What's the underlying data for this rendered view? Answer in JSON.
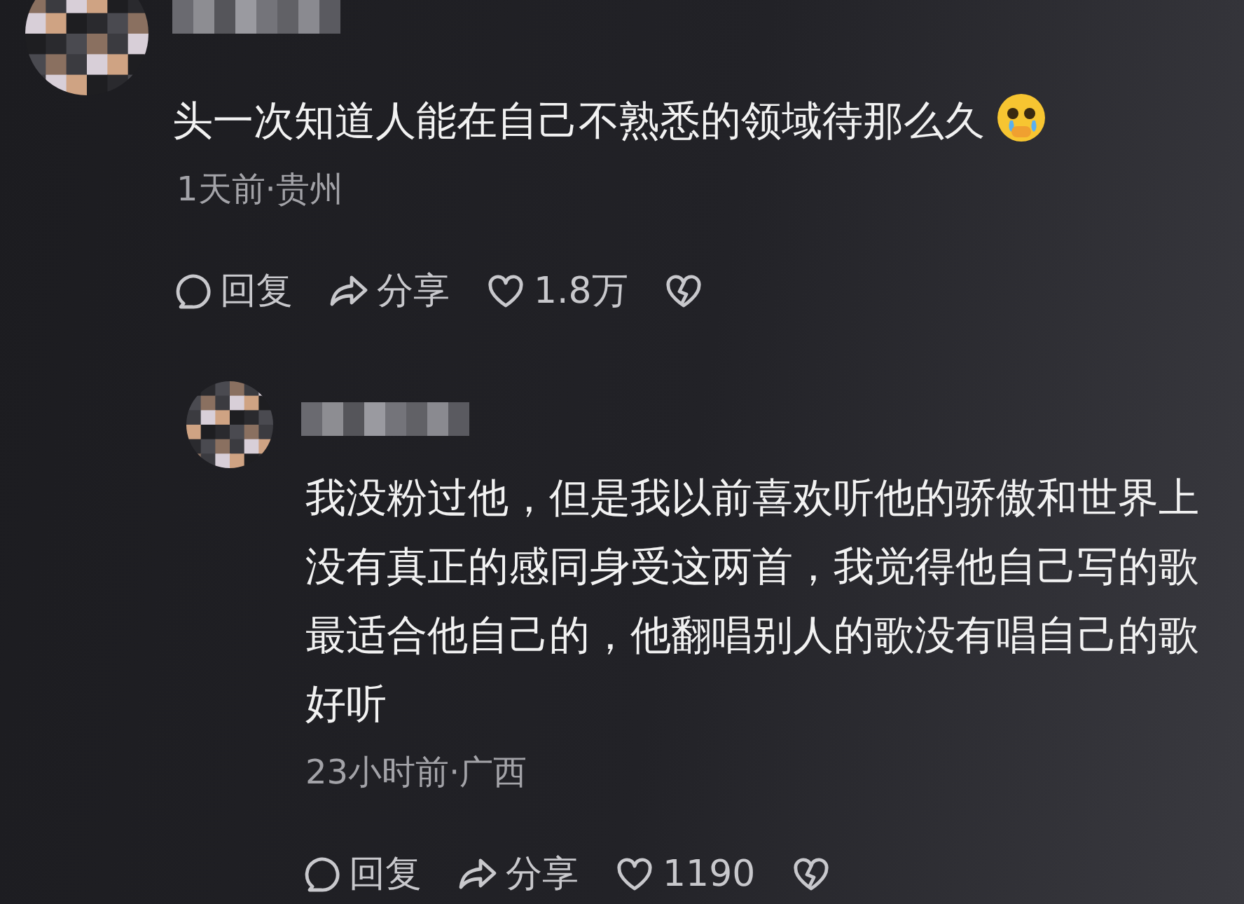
{
  "comments": [
    {
      "kind": "top",
      "text": "头一次知道人能在自己不熟悉的领域待那么久",
      "emoji": true,
      "meta": "1天前·贵州",
      "actions": {
        "reply": "回复",
        "share": "分享",
        "likes": "1.8万"
      }
    },
    {
      "kind": "reply",
      "text": "我没粉过他，但是我以前喜欢听他的骄傲和世界上没有真正的感同身受这两首，我觉得他自己写的歌最适合他自己的，他翻唱别人的歌没有唱自己的歌好听",
      "emoji": false,
      "meta": "23小时前·广西",
      "actions": {
        "reply": "回复",
        "share": "分享",
        "likes": "1190"
      }
    }
  ]
}
